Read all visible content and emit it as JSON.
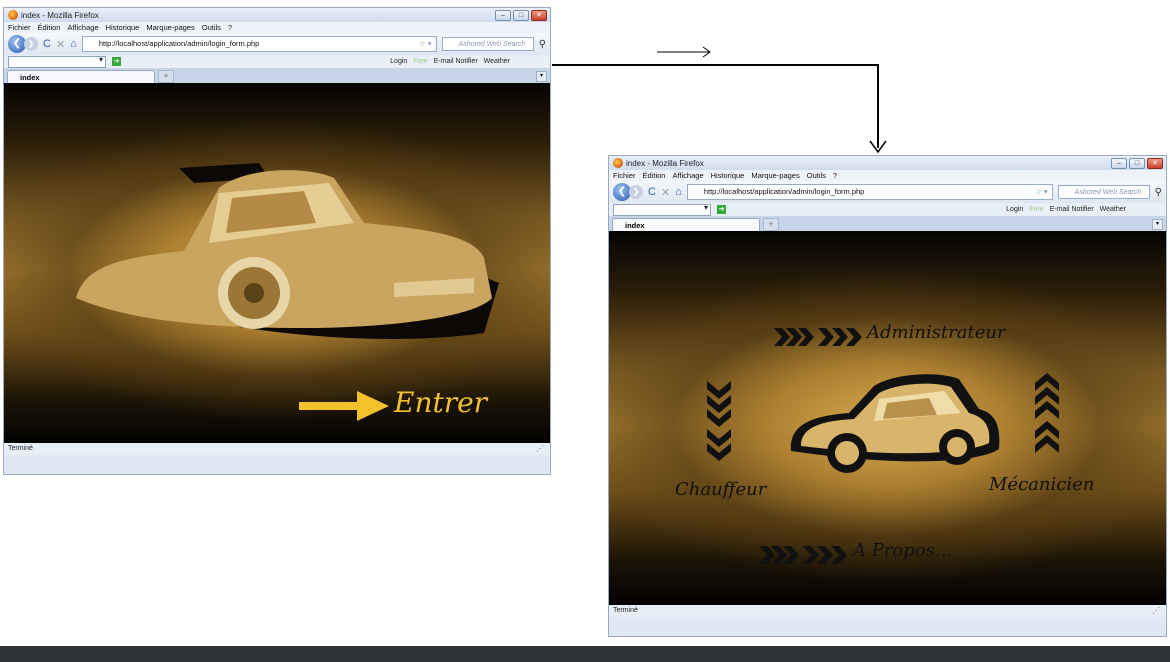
{
  "browser": {
    "title": "index - Mozilla Firefox",
    "menu": [
      "Fichier",
      "Édition",
      "Affichage",
      "Historique",
      "Marque-pages",
      "Outils",
      "?"
    ],
    "url_1": "http://localhost/application/admin/login_form.php",
    "url_2": "http://localhost/application/admin/login_form.php",
    "search_placeholder": "Ashored Web Search",
    "toolbar_items": [
      "Login",
      "Free",
      "E-mail Notifier",
      "Weather"
    ],
    "tab_label": "index",
    "status": "Terminé"
  },
  "page1": {
    "enter_label": "Entrer"
  },
  "page2": {
    "admin_label": "Administrateur",
    "driver_label": "Chauffeur",
    "mechanic_label": "Mécanicien",
    "about_label": "A Propos..."
  },
  "colors": {
    "gold": "#f2c12c",
    "arrow": "#000000"
  },
  "icons": [
    "firefox-logo-icon",
    "back-icon",
    "forward-icon",
    "reload-icon",
    "stop-icon",
    "home-icon",
    "bookmark-star-icon",
    "search-icon",
    "chevron-icon",
    "car-illustration"
  ]
}
